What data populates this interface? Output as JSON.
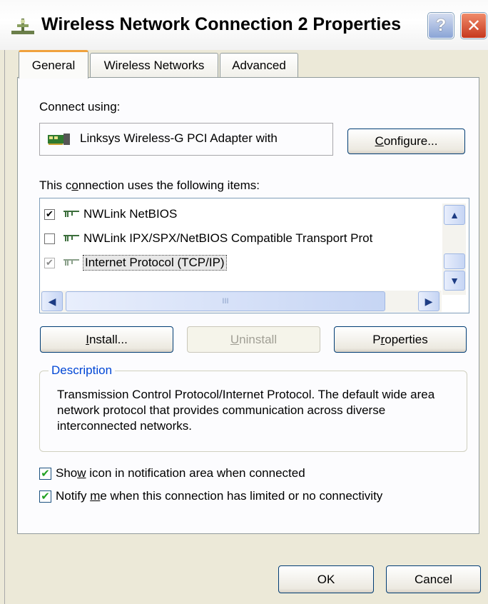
{
  "window": {
    "title": "Wireless Network Connection 2 Properties",
    "help_glyph": "?",
    "close_glyph": "✕"
  },
  "tabs": [
    {
      "label": "General",
      "active": true
    },
    {
      "label": "Wireless Networks",
      "active": false
    },
    {
      "label": "Advanced",
      "active": false
    }
  ],
  "general": {
    "connect_using_label": "Connect using:",
    "adapter_name": "Linksys Wireless-G PCI Adapter with",
    "configure": {
      "pre": "",
      "ul": "C",
      "post": "onfigure..."
    },
    "items_label": {
      "pre": "This c",
      "ul": "o",
      "post": "nnection uses the following items:"
    },
    "items": [
      {
        "label": "NWLink NetBIOS",
        "checked": true,
        "style": "normal"
      },
      {
        "label": "NWLink IPX/SPX/NetBIOS Compatible Transport Prot",
        "checked": false,
        "style": "normal"
      },
      {
        "label": "Internet Protocol (TCP/IP)",
        "checked": true,
        "style": "grey",
        "selected": true
      }
    ],
    "scroll_up": "▲",
    "scroll_down": "▼",
    "scroll_left": "◀",
    "scroll_right": "▶",
    "hscroll_grip": "III",
    "install": {
      "pre": "",
      "ul": "I",
      "post": "nstall..."
    },
    "uninstall": {
      "pre": "",
      "ul": "U",
      "post": "ninstall"
    },
    "properties": {
      "pre": "P",
      "ul": "r",
      "post": "operties"
    },
    "description_legend": "Description",
    "description_text": "Transmission Control Protocol/Internet Protocol. The default wide area network protocol that provides communication across diverse interconnected networks.",
    "show_icon": {
      "pre": "Sho",
      "ul": "w",
      "post": " icon in notification area when connected",
      "checked": true
    },
    "notify": {
      "pre": "Notify ",
      "ul": "m",
      "post": "e when this connection has limited or no connectivity",
      "checked": true
    }
  },
  "footer": {
    "ok": "OK",
    "cancel": "Cancel"
  },
  "icons": {
    "title": "network-connection-icon",
    "adapter": "network-adapter-icon",
    "protocol": "network-protocol-icon"
  },
  "colors": {
    "face": "#ECE9D8",
    "panel": "#FCFCFE",
    "accent_tab": "#F0A23C",
    "legend": "#0046D5",
    "check_green": "#21A121",
    "button_border": "#003C74"
  }
}
